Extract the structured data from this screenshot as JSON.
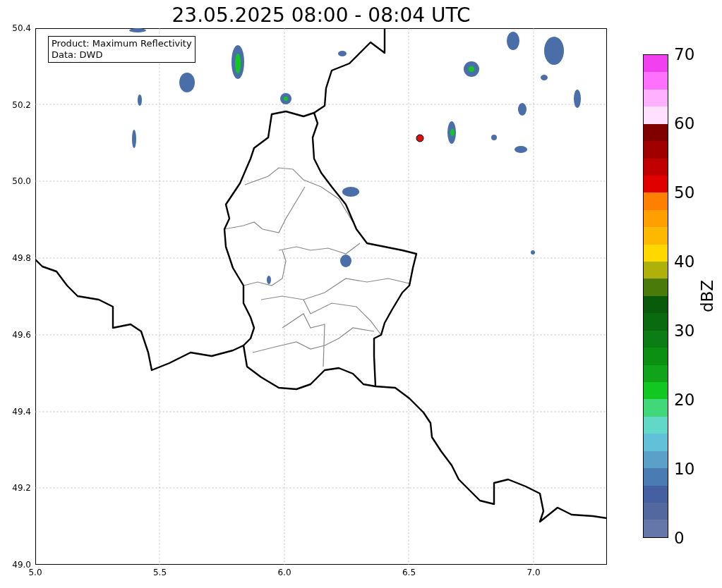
{
  "title": "23.05.2025 08:00 - 08:04 UTC",
  "legend": [
    "Product: Maximum Reflectivity",
    "Data: DWD"
  ],
  "y_ticks": [
    "50.4",
    "50.2",
    "50.0",
    "49.8",
    "49.6",
    "49.4",
    "49.2",
    "49.0"
  ],
  "x_ticks": [
    "5.0",
    "5.5",
    "6.0",
    "6.5",
    "7.0"
  ],
  "colorbar": {
    "label": "dBZ",
    "ticks": [
      "70",
      "60",
      "50",
      "40",
      "30",
      "20",
      "10",
      "0"
    ],
    "segments": [
      {
        "color": "#f040f0"
      },
      {
        "color": "#ff70ff"
      },
      {
        "color": "#ffb0ff"
      },
      {
        "color": "#ffe0ff"
      },
      {
        "color": "#800000"
      },
      {
        "color": "#a00000"
      },
      {
        "color": "#c00000"
      },
      {
        "color": "#e00000"
      },
      {
        "color": "#ff8000"
      },
      {
        "color": "#ffa000"
      },
      {
        "color": "#ffb800"
      },
      {
        "color": "#ffd800"
      },
      {
        "color": "#b0b00a"
      },
      {
        "color": "#4a7a0a"
      },
      {
        "color": "#0a5a0c"
      },
      {
        "color": "#0a6a10"
      },
      {
        "color": "#0c7c14"
      },
      {
        "color": "#0c9014"
      },
      {
        "color": "#10a41a"
      },
      {
        "color": "#12c820"
      },
      {
        "color": "#40d878"
      },
      {
        "color": "#62d8c8"
      },
      {
        "color": "#62c0d8"
      },
      {
        "color": "#5ba0c8"
      },
      {
        "color": "#4a7bb2"
      },
      {
        "color": "#4460a0"
      },
      {
        "color": "#5468a0"
      },
      {
        "color": "#6577a8"
      }
    ]
  }
}
